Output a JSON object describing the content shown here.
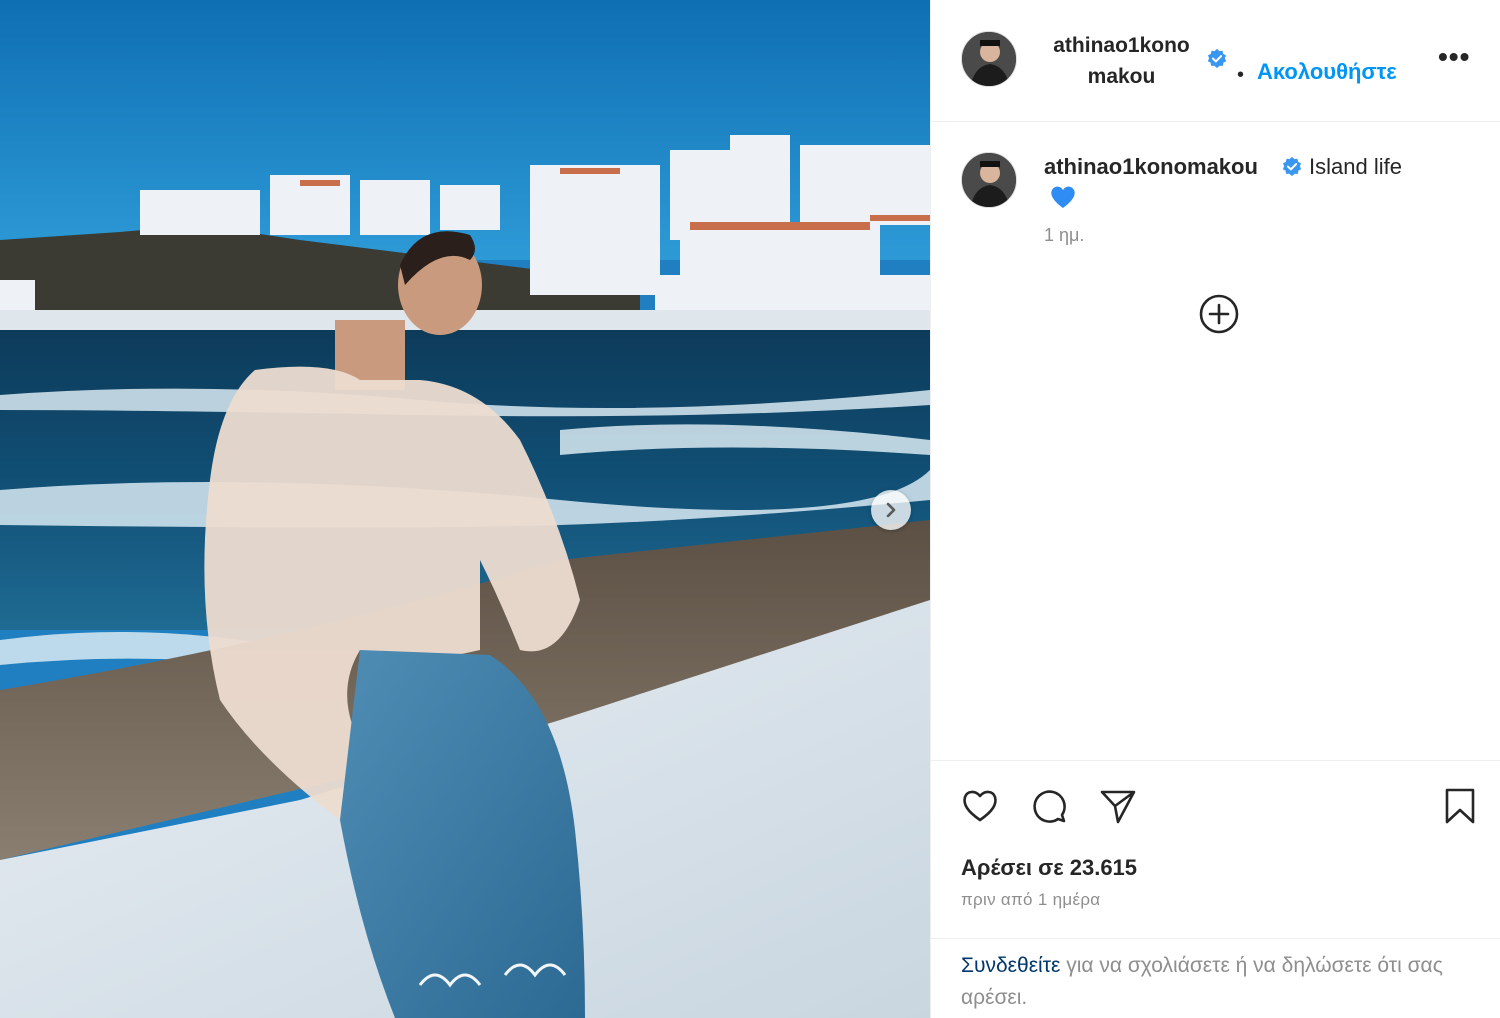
{
  "post": {
    "username_line1": "athinao1kono",
    "username_line2": "makou",
    "username": "athinao1konomakou",
    "follow_label": "Ακολουθήστε",
    "separator": "•",
    "more_label": "•••"
  },
  "caption": {
    "username": "athinao1konomakou",
    "text": "Island life",
    "emoji": "blue-heart-icon",
    "time": "1 ημ."
  },
  "engagement": {
    "likes": "Αρέσει σε 23.615",
    "posted": "πριν από 1 ημέρα"
  },
  "login_prompt": {
    "link": "Συνδεθείτε",
    "rest": " για να σχολιάσετε ή να δηλώσετε ότι σας αρέσει."
  },
  "colors": {
    "accent": "#0095f6",
    "link_dark": "#00376b",
    "muted": "#8e8e8e",
    "verified": "#3897f0",
    "heart": "#2f8cf5"
  },
  "icons": {
    "like": "heart-outline-icon",
    "comment": "comment-icon",
    "share": "paper-plane-icon",
    "save": "bookmark-icon",
    "add": "plus-circle-icon",
    "next": "chevron-right-icon"
  }
}
